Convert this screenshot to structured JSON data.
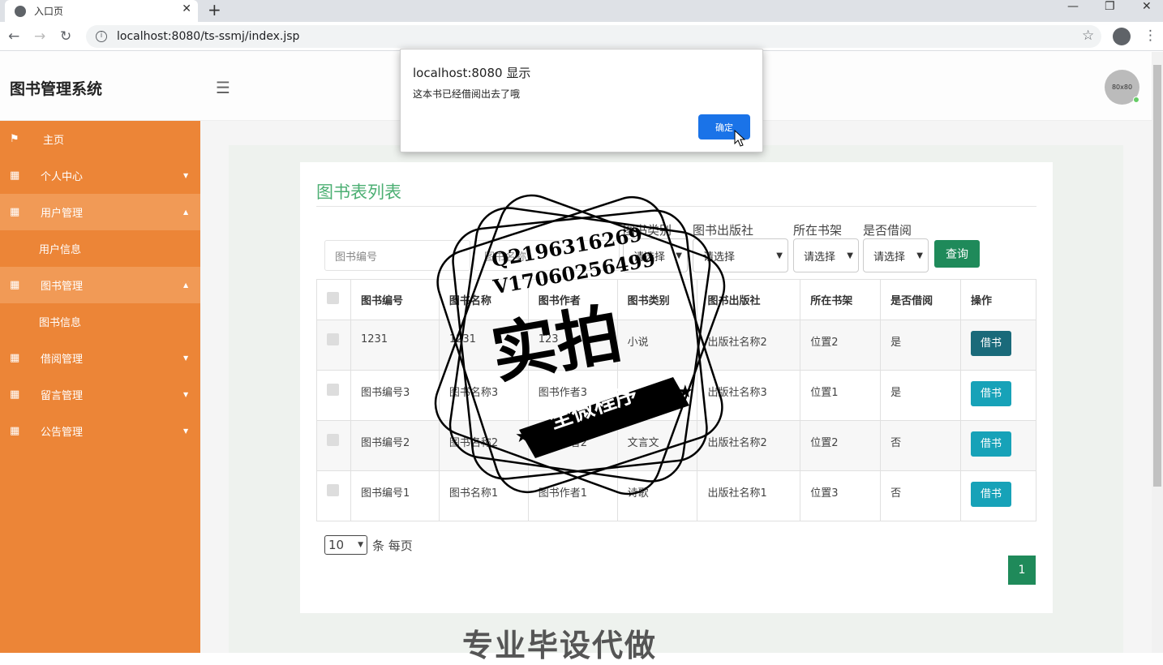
{
  "browser": {
    "tab_title": "入口页",
    "url": "localhost:8080/ts-ssmj/index.jsp"
  },
  "header": {
    "app_title": "图书管理系统",
    "avatar_text": "80x80"
  },
  "sidebar": {
    "items": [
      {
        "label": "主页"
      },
      {
        "label": "个人中心"
      },
      {
        "label": "用户管理"
      },
      {
        "label": "用户信息"
      },
      {
        "label": "图书管理"
      },
      {
        "label": "图书信息"
      },
      {
        "label": "借阅管理"
      },
      {
        "label": "留言管理"
      },
      {
        "label": "公告管理"
      }
    ]
  },
  "main": {
    "title": "图书表列表",
    "filters": {
      "book_no_placeholder": "图书编号",
      "book_name_placeholder": "图书名称",
      "category_label": "图书类别",
      "category_value": "请选择",
      "publisher_label": "图书出版社",
      "publisher_value": "请选择",
      "shelf_label": "所在书架",
      "shelf_value": "请选择",
      "borrowed_label": "是否借阅",
      "borrowed_value": "请选择",
      "query_button": "查询"
    },
    "table": {
      "headers": [
        "图书编号",
        "图书名称",
        "图书作者",
        "图书类别",
        "图书出版社",
        "所在书架",
        "是否借阅",
        "操作"
      ],
      "rows": [
        {
          "no": "1231",
          "name": "1231",
          "author": "123",
          "category": "小说",
          "publisher": "出版社名称2",
          "shelf": "位置2",
          "borrowed": "是",
          "action": "借书"
        },
        {
          "no": "图书编号3",
          "name": "图书名称3",
          "author": "图书作者3",
          "category": "",
          "publisher": "出版社名称3",
          "shelf": "位置1",
          "borrowed": "是",
          "action": "借书"
        },
        {
          "no": "图书编号2",
          "name": "图书名称2",
          "author": "图书作者2",
          "category": "文言文",
          "publisher": "出版社名称2",
          "shelf": "位置2",
          "borrowed": "否",
          "action": "借书"
        },
        {
          "no": "图书编号1",
          "name": "图书名称1",
          "author": "图书作者1",
          "category": "诗歌",
          "publisher": "出版社名称1",
          "shelf": "位置3",
          "borrowed": "否",
          "action": "借书"
        }
      ]
    },
    "pagination": {
      "per_page": "10",
      "per_page_suffix": "条 每页",
      "current_page": "1"
    }
  },
  "dialog": {
    "title": "localhost:8080 显示",
    "message": "这本书已经借阅出去了哦",
    "ok": "确定"
  },
  "watermark": {
    "line1": "Q2196316269",
    "line2": "V17060256499",
    "big": "实拍",
    "banner": "全微程序",
    "bottom": "专业毕设代做"
  }
}
